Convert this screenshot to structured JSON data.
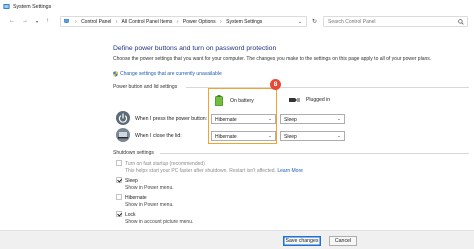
{
  "window": {
    "title": "System Settings",
    "icon": "power-options-icon"
  },
  "address": {
    "breadcrumbs": [
      "Control Panel",
      "All Control Panel Items",
      "Power Options",
      "System Settings"
    ],
    "search_placeholder": "Search Control Panel"
  },
  "main": {
    "heading": "Define power buttons and turn on password protection",
    "description": "Choose the power settings that you want for your computer. The changes you make to the settings on this page apply to all of your power plans.",
    "change_link": "Change settings that are currently unavailable",
    "power_group_label": "Power button and lid settings",
    "columns": {
      "on_battery": "On battery",
      "plugged_in": "Plugged in"
    },
    "rows": [
      {
        "label": "When I press the power button:",
        "battery": "Hibernate",
        "plugged": "Sleep"
      },
      {
        "label": "When I close the lid:",
        "battery": "Hibernate",
        "plugged": "Sleep"
      }
    ],
    "badge_number": "8",
    "highlight_color": "#f2a52c",
    "badge_color": "#e74b36",
    "shutdown_group_label": "Shutdown settings",
    "shutdown_items": [
      {
        "label": "Turn on fast startup (recommended)",
        "checked": false,
        "enabled": false,
        "sub": "This helps start your PC faster after shutdown. Restart isn't affected.",
        "sub_link": "Learn More"
      },
      {
        "label": "Sleep",
        "checked": true,
        "enabled": false,
        "sub": "Show in Power menu."
      },
      {
        "label": "Hibernate",
        "checked": false,
        "enabled": false,
        "sub": "Show in Power menu."
      },
      {
        "label": "Lock",
        "checked": true,
        "enabled": false,
        "sub": "Show in account picture menu."
      }
    ]
  },
  "footer": {
    "save_label": "Save changes",
    "cancel_label": "Cancel"
  },
  "colors": {
    "link": "#1b5fb5",
    "heading": "#1e3287",
    "primary_button_border": "#1a73d4"
  }
}
